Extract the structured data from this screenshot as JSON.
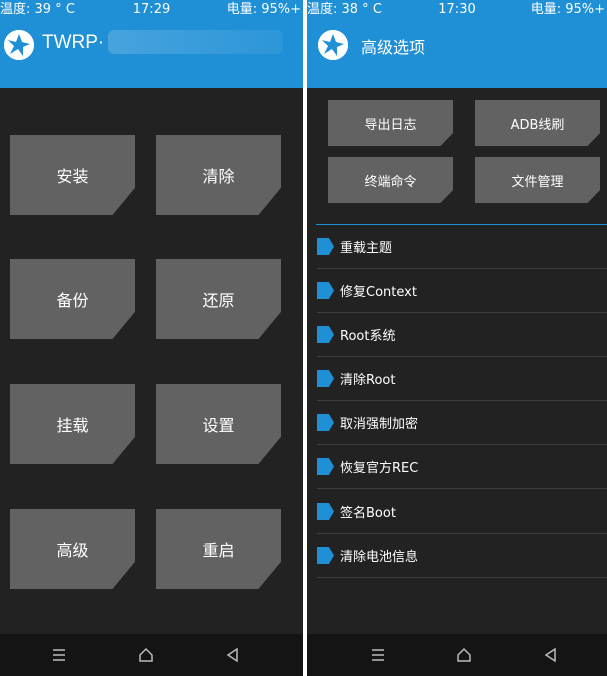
{
  "left": {
    "status": {
      "temperature": "温度: 39 ° C",
      "time": "17:29",
      "battery": "电量: 95%+"
    },
    "header": {
      "title": "TWRP·"
    },
    "buttons": [
      "安装",
      "清除",
      "备份",
      "还原",
      "挂载",
      "设置",
      "高级",
      "重启"
    ]
  },
  "right": {
    "status": {
      "temperature": "温度: 38 ° C",
      "time": "17:30",
      "battery": "电量: 95%+"
    },
    "header": {
      "title": "高级选项"
    },
    "buttons": [
      "导出日志",
      "ADB线刷",
      "终端命令",
      "文件管理"
    ],
    "list": [
      "重载主题",
      "修复Context",
      "Root系统",
      "清除Root",
      "取消强制加密",
      "恢复官方REC",
      "签名Boot",
      "清除电池信息"
    ]
  },
  "navbar": {
    "icons": [
      "menu-icon",
      "home-icon",
      "back-icon"
    ]
  },
  "colors": {
    "accent": "#1f8fd6",
    "background": "#222222",
    "button": "#626262",
    "navbar": "#141414"
  }
}
